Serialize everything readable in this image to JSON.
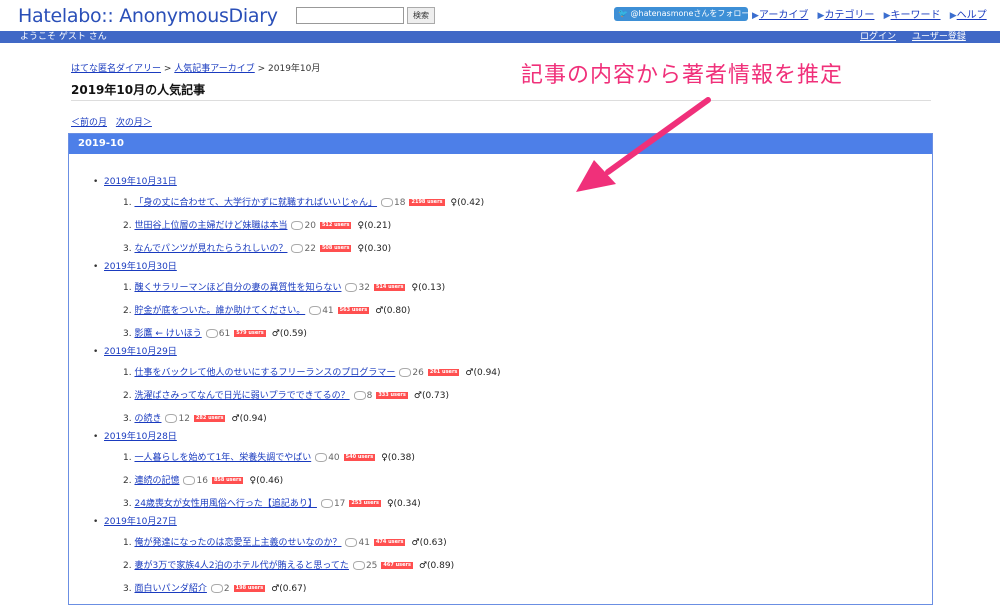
{
  "header": {
    "logo": "Hatelabo:: AnonymousDiary",
    "search_button": "検索",
    "follow": "@hatenasmoneさんをフォロー",
    "nav": [
      "アーカイブ",
      "カテゴリー",
      "キーワード",
      "ヘルプ"
    ],
    "welcome": "ようこそ ゲスト さん",
    "login": "ログイン",
    "register": "ユーザー登録"
  },
  "breadcrumb": {
    "home": "はてな匿名ダイアリー",
    "archive": "人気記事アーカイブ",
    "current": "2019年10月"
  },
  "page_title": "2019年10月の人気記事",
  "month_nav": {
    "prev": "＜前の月",
    "next": "次の月＞"
  },
  "section_title": "2019-10",
  "annotation": "記事の内容から著者情報を推定",
  "colors": {
    "accent": "#4d7fe8",
    "users_badge": "#ff4f4f",
    "annotation": "#f0307a"
  },
  "days": [
    {
      "date": "2019年10月31日",
      "entries": [
        {
          "num": "1.",
          "title": "「身の丈に合わせて、大学行かずに就職すればいいじゃん」",
          "comments": "18",
          "users": "2198 users",
          "gender": "♀",
          "score": "(0.42)"
        },
        {
          "num": "2.",
          "title": "世田谷上位層の主婦だけど妹職は本当",
          "comments": "20",
          "users": "512 users",
          "gender": "♀",
          "score": "(0.21)"
        },
        {
          "num": "3.",
          "title": "なんでパンツが見れたらうれしいの？",
          "comments": "22",
          "users": "508 users",
          "gender": "♀",
          "score": "(0.30)"
        }
      ]
    },
    {
      "date": "2019年10月30日",
      "entries": [
        {
          "num": "1.",
          "title": "醜くサラリーマンほど自分の妻の異質性を知らない",
          "comments": "32",
          "users": "514 users",
          "gender": "♀",
          "score": "(0.13)"
        },
        {
          "num": "2.",
          "title": "貯金が底をついた。誰か助けてください。",
          "comments": "41",
          "users": "563 users",
          "gender": "♂",
          "score": "(0.80)"
        },
        {
          "num": "3.",
          "title": "影鷹 ← けいほう",
          "comments": "61",
          "users": "579 users",
          "gender": "♂",
          "score": "(0.59)"
        }
      ]
    },
    {
      "date": "2019年10月29日",
      "entries": [
        {
          "num": "1.",
          "title": "仕事をバックレて他人のせいにするフリーランスのプログラマー",
          "comments": "26",
          "users": "261 users",
          "gender": "♂",
          "score": "(0.94)"
        },
        {
          "num": "2.",
          "title": "洗濯ばさみってなんで日光に弱いプラでできてるの？",
          "comments": "8",
          "users": "333 users",
          "gender": "♂",
          "score": "(0.73)"
        },
        {
          "num": "3.",
          "title": "の続き",
          "comments": "12",
          "users": "282 users",
          "gender": "♂",
          "score": "(0.94)"
        }
      ]
    },
    {
      "date": "2019年10月28日",
      "entries": [
        {
          "num": "1.",
          "title": "一人暮らしを始めて1年、栄養失調でやばい",
          "comments": "40",
          "users": "540 users",
          "gender": "♀",
          "score": "(0.38)"
        },
        {
          "num": "2.",
          "title": "連続の記憶",
          "comments": "16",
          "users": "858 users",
          "gender": "♀",
          "score": "(0.46)"
        },
        {
          "num": "3.",
          "title": "24歳喪女が女性用風俗へ行った【追記あり】",
          "comments": "17",
          "users": "253 users",
          "gender": "♀",
          "score": "(0.34)"
        }
      ]
    },
    {
      "date": "2019年10月27日",
      "entries": [
        {
          "num": "1.",
          "title": "俺が発達になったのは恋愛至上主義のせいなのか？",
          "comments": "41",
          "users": "474 users",
          "gender": "♂",
          "score": "(0.63)"
        },
        {
          "num": "2.",
          "title": "妻が3万で家族4人2泊のホテル代が賄えると思ってた",
          "comments": "25",
          "users": "467 users",
          "gender": "♂",
          "score": "(0.89)"
        },
        {
          "num": "3.",
          "title": "面白いパンダ紹介",
          "comments": "2",
          "users": "198 users",
          "gender": "♂",
          "score": "(0.67)"
        }
      ]
    }
  ]
}
